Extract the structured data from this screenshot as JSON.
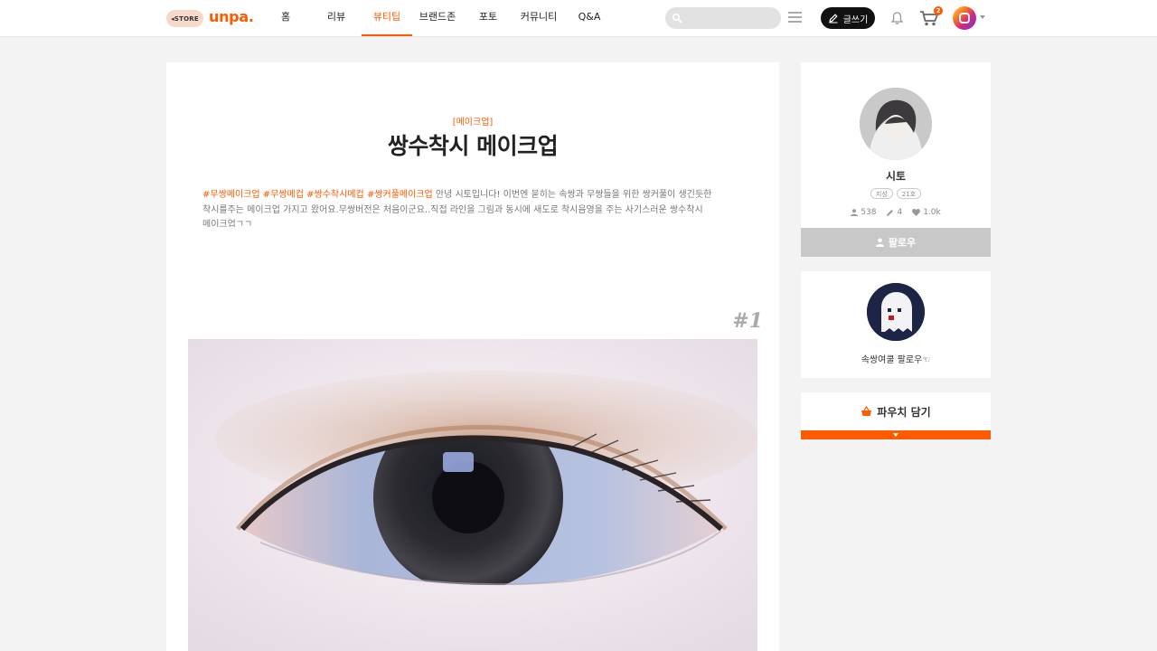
{
  "header": {
    "store_label": "◂STORE",
    "logo": "unpa.",
    "nav": [
      {
        "label": "홈",
        "active": false
      },
      {
        "label": "리뷰",
        "active": false
      },
      {
        "label": "뷰티팁",
        "active": true
      },
      {
        "label": "브랜드존",
        "active": false
      },
      {
        "label": "포토",
        "active": false
      },
      {
        "label": "커뮤니티",
        "active": false
      },
      {
        "label": "Q&A",
        "active": false
      }
    ],
    "search_placeholder": "",
    "write_label": "글쓰기",
    "cart_count": "2"
  },
  "article": {
    "category": "[메이크업]",
    "title": "쌍수착시 메이크업",
    "tags": [
      "#무쌍메이크업",
      "#무쌍메컵",
      "#쌍수착시메컵",
      "#쌍커풀메이크업"
    ],
    "intro_text": "안녕 시토입니다! 이번엔 묻히는 속쌍과 무쌍들을 위한 쌍커풀이 생긴듯한 착시를주는 메이크업 가지고 왔어요.무쌍버전은 처음이군요..직접 라인을 그림과 동시에 새도로 착시음영을 주는 사기스러운 쌍수착시 메이크업ㄱㄱ",
    "step_number": "#1"
  },
  "profile": {
    "username": "시토",
    "badges": [
      "지성",
      "21호"
    ],
    "followers": "538",
    "posts": "4",
    "likes": "1.0k",
    "follow_label": "팔로우"
  },
  "promo": {
    "label": "속쌍여쿨 팔로우☜"
  },
  "pouch": {
    "label": "파우치 담기"
  },
  "colors": {
    "accent": "#ff5a00",
    "header_bg": "#ffffff",
    "page_bg": "#f3f3f3"
  }
}
